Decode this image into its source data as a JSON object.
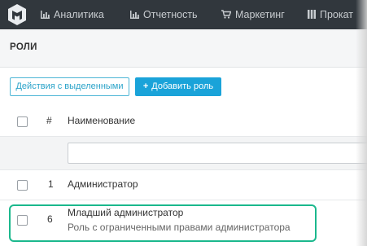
{
  "nav": {
    "items": [
      {
        "label": "Аналитика",
        "icon": "bar-chart-icon"
      },
      {
        "label": "Отчетность",
        "icon": "bar-chart-icon"
      },
      {
        "label": "Маркетинг",
        "icon": "cart-icon"
      },
      {
        "label": "Прокат",
        "icon": "columns-icon"
      }
    ]
  },
  "page": {
    "title": "РОЛИ"
  },
  "toolbar": {
    "bulk_actions_label": "Действия с выделенными",
    "add_role_label": "Добавить роль",
    "add_role_icon": "plus-icon"
  },
  "table": {
    "headers": {
      "num": "#",
      "name": "Наименование"
    },
    "filter_value": "",
    "rows": [
      {
        "id": "1",
        "name": "Администратор",
        "description": ""
      },
      {
        "id": "6",
        "name": "Младший администратор",
        "description": "Роль с ограниченными правами администратора"
      }
    ]
  },
  "colors": {
    "topbar": "#31373d",
    "accent": "#1aa3d9",
    "highlight": "#1bb88d"
  }
}
